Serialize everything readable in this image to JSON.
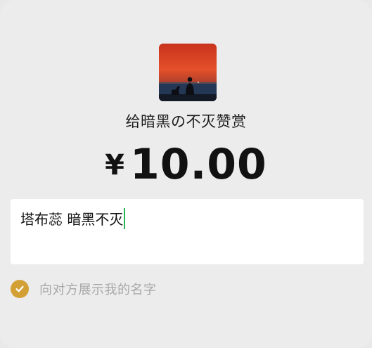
{
  "recipient": {
    "avatar_name": "avatar-sunset-silhouette",
    "title": "给暗黑の不灭赞赏"
  },
  "amount": {
    "currency_symbol": "¥",
    "value": "10.00"
  },
  "message": {
    "text": "塔布蕊 暗黑不灭"
  },
  "options": {
    "show_name_label": "向对方展示我的名字",
    "show_name_checked": true
  },
  "colors": {
    "background": "#ececec",
    "accent": "#d3a035",
    "caret": "#2bb35a",
    "hint_text": "#a8a8a8"
  }
}
